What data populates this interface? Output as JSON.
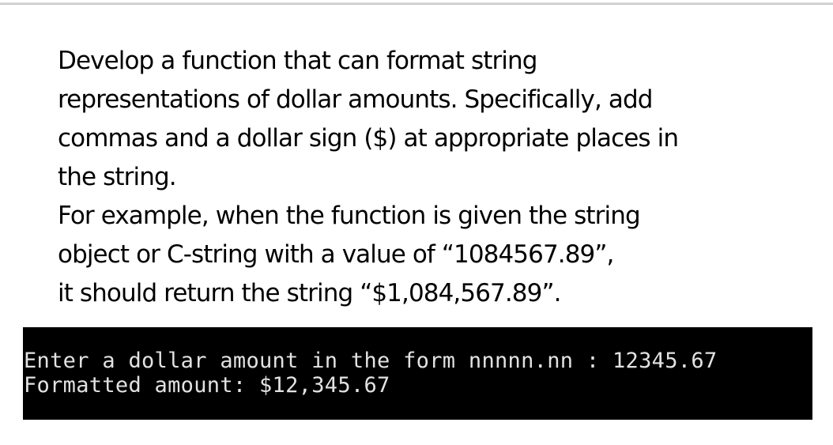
{
  "prompt": {
    "lines": [
      "Develop a function that can format string",
      "representations of dollar amounts. Specifically, add",
      "commas and a dollar  sign ($) at appropriate places in",
      "the string.",
      "For example, when the function is given the string",
      "object or C-string with a value of “1084567.89”,",
      "it should return the string “$1,084,567.89”."
    ]
  },
  "console": {
    "lines": [
      "Enter a dollar amount in the form nnnnn.nn : 12345.67",
      "Formatted amount: $12,345.67"
    ],
    "background": "#000000",
    "text_color": "#e2e2e2"
  }
}
